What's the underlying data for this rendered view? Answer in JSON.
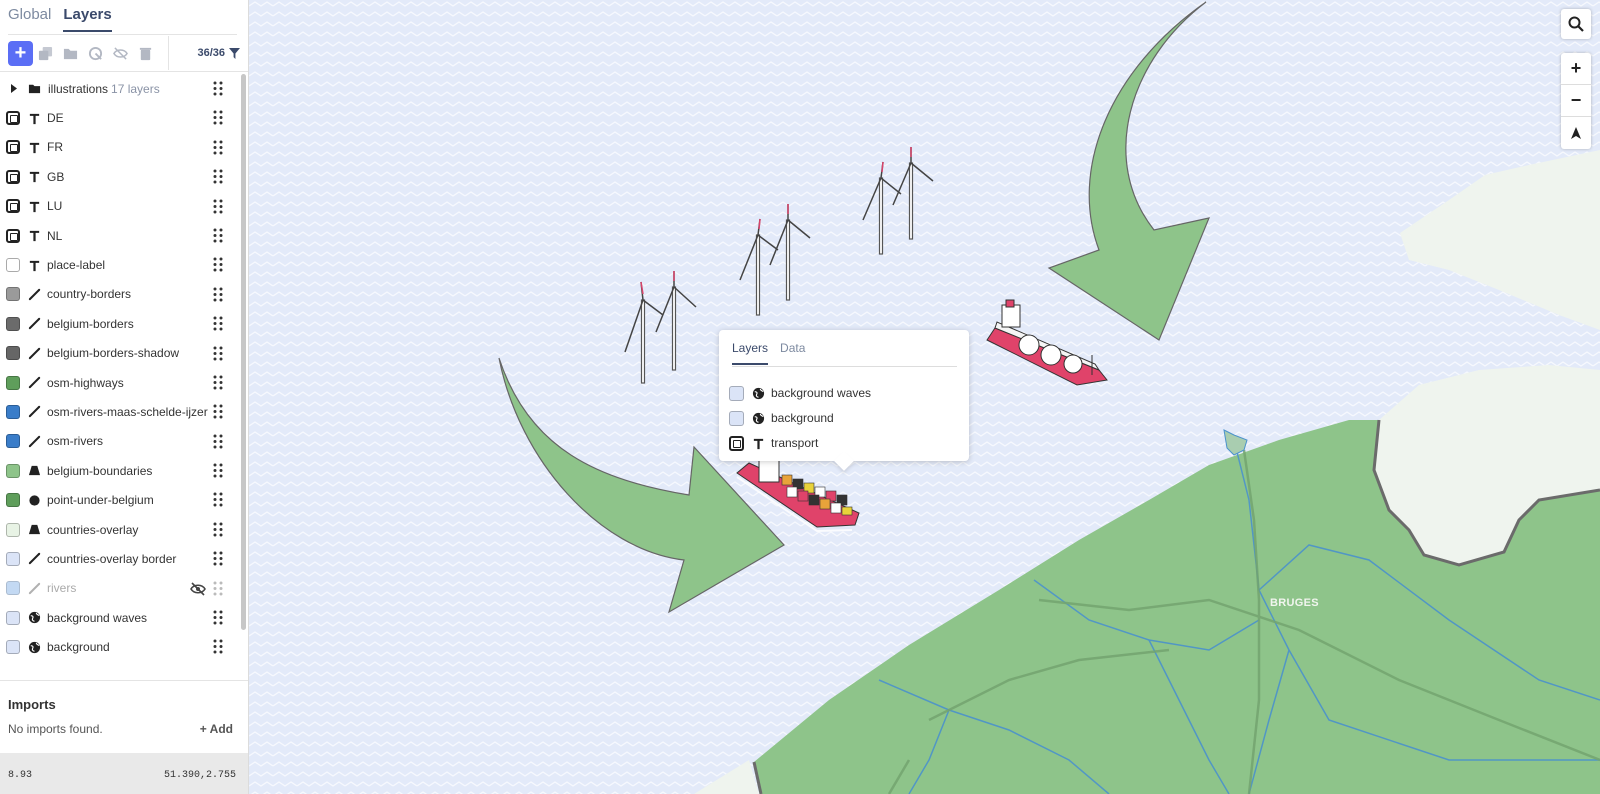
{
  "sidebar": {
    "tabs": [
      "Global",
      "Layers"
    ],
    "active_tab": "Layers",
    "layer_count": "36/36",
    "layers": [
      {
        "name": "illustrations",
        "count": "17 layers",
        "type": "folder"
      },
      {
        "name": "DE",
        "type": "symbol",
        "swatch": "image"
      },
      {
        "name": "FR",
        "type": "symbol",
        "swatch": "image"
      },
      {
        "name": "GB",
        "type": "symbol",
        "swatch": "image"
      },
      {
        "name": "LU",
        "type": "symbol",
        "swatch": "image"
      },
      {
        "name": "NL",
        "type": "symbol",
        "swatch": "image"
      },
      {
        "name": "place-label",
        "type": "symbol",
        "swatch": "#ffffff"
      },
      {
        "name": "country-borders",
        "type": "line",
        "swatch": "#9a9a9a"
      },
      {
        "name": "belgium-borders",
        "type": "line",
        "swatch": "#6b6b6b"
      },
      {
        "name": "belgium-borders-shadow",
        "type": "line",
        "swatch": "#666666"
      },
      {
        "name": "osm-highways",
        "type": "line",
        "swatch": "#5f9e5b"
      },
      {
        "name": "osm-rivers-maas-schelde-ijzer",
        "type": "line",
        "swatch": "#3a7dc9"
      },
      {
        "name": "osm-rivers",
        "type": "line",
        "swatch": "#3a7dc9"
      },
      {
        "name": "belgium-boundaries",
        "type": "fill",
        "swatch": "#8ec48a"
      },
      {
        "name": "point-under-belgium",
        "type": "circle",
        "swatch": "#5f9e5b"
      },
      {
        "name": "countries-overlay",
        "type": "fill",
        "swatch": "#e8f3e5"
      },
      {
        "name": "countries-overlay border",
        "type": "line",
        "swatch": "#dbe4f7"
      },
      {
        "name": "rivers",
        "type": "line",
        "swatch": "#9cc0ec",
        "hidden": true
      },
      {
        "name": "background waves",
        "type": "background",
        "swatch": "#dbe4f7"
      },
      {
        "name": "background",
        "type": "background",
        "swatch": "#dbe4f7"
      }
    ]
  },
  "imports": {
    "title": "Imports",
    "empty_text": "No imports found.",
    "add_label": "Add"
  },
  "status": {
    "zoom": "8.93",
    "coords": "51.390,2.755"
  },
  "map": {
    "city_label": "BRUGES",
    "popup": {
      "tabs": [
        "Layers",
        "Data"
      ],
      "active_tab": "Layers",
      "layers": [
        {
          "name": "background waves",
          "type": "background",
          "swatch": "#dbe4f7"
        },
        {
          "name": "background",
          "type": "background",
          "swatch": "#dbe4f7"
        },
        {
          "name": "transport",
          "type": "symbol",
          "swatch": "image"
        }
      ]
    }
  },
  "colors": {
    "accent": "#5b6ef5",
    "sea": "#e3eaf9",
    "land_belgium": "#8ec48a",
    "land_other": "#eff4ee",
    "arrow": "#8ec48a",
    "ship_hull": "#e0436a"
  }
}
